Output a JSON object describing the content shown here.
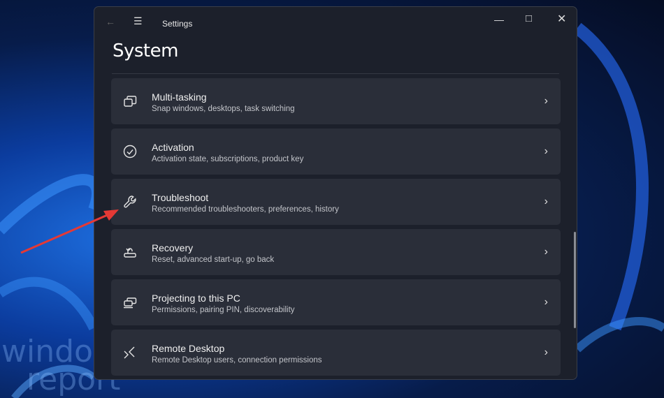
{
  "window": {
    "title": "Settings",
    "page_title": "System"
  },
  "items": [
    {
      "title": "Multi-tasking",
      "subtitle": "Snap windows, desktops, task switching",
      "icon": "multitasking-icon"
    },
    {
      "title": "Activation",
      "subtitle": "Activation state, subscriptions, product key",
      "icon": "check-circle-icon"
    },
    {
      "title": "Troubleshoot",
      "subtitle": "Recommended troubleshooters, preferences, history",
      "icon": "wrench-icon"
    },
    {
      "title": "Recovery",
      "subtitle": "Reset, advanced start-up, go back",
      "icon": "recovery-icon"
    },
    {
      "title": "Projecting to this PC",
      "subtitle": "Permissions, pairing PIN, discoverability",
      "icon": "projector-icon"
    },
    {
      "title": "Remote Desktop",
      "subtitle": "Remote Desktop users, connection permissions",
      "icon": "remote-desktop-icon"
    }
  ],
  "watermark": {
    "line1": "windows",
    "line2": "report"
  },
  "colors": {
    "annotation_arrow": "#e53935",
    "window_bg": "#1c202b",
    "card_bg": "#2a2e39"
  }
}
